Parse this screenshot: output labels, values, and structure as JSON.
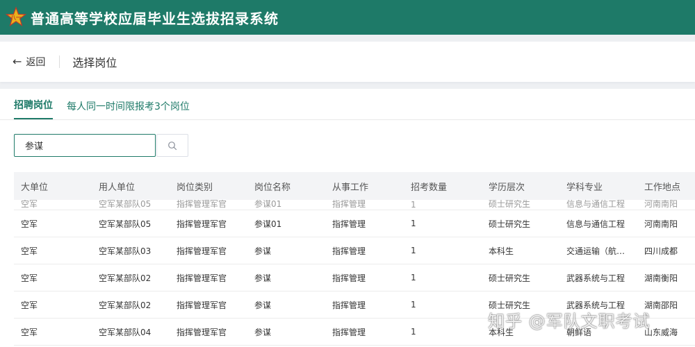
{
  "header": {
    "title": "普通高等学校应届毕业生选拔招录系统",
    "logo_icon": "army-emblem-icon",
    "brand_color": "#1e7a68"
  },
  "subheader": {
    "back_label": "返回",
    "page_title": "选择岗位"
  },
  "tabs": {
    "active_label": "招聘岗位",
    "note": "每人同一时间限报考3个岗位"
  },
  "search": {
    "value": "参谋",
    "icon": "search-icon"
  },
  "table": {
    "columns": [
      "大单位",
      "用人单位",
      "岗位类别",
      "岗位名称",
      "从事工作",
      "招考数量",
      "学历层次",
      "学科专业",
      "工作地点"
    ],
    "partial_row": [
      "空军",
      "空军某部队05",
      "指挥管理军官",
      "参谋01",
      "指挥管理",
      "1",
      "硕士研究生",
      "信息与通信工程",
      "河南南阳"
    ],
    "rows": [
      [
        "空军",
        "空军某部队05",
        "指挥管理军官",
        "参谋01",
        "指挥管理",
        "1",
        "硕士研究生",
        "信息与通信工程",
        "河南南阳"
      ],
      [
        "空军",
        "空军某部队03",
        "指挥管理军官",
        "参谋",
        "指挥管理",
        "1",
        "本科生",
        "交通运输（航…",
        "四川成都"
      ],
      [
        "空军",
        "空军某部队02",
        "指挥管理军官",
        "参谋",
        "指挥管理",
        "1",
        "硕士研究生",
        "武器系统与工程",
        "湖南衡阳"
      ],
      [
        "空军",
        "空军某部队02",
        "指挥管理军官",
        "参谋",
        "指挥管理",
        "1",
        "硕士研究生",
        "武器系统与工程",
        "湖南邵阳"
      ],
      [
        "空军",
        "空军某部队04",
        "指挥管理军官",
        "参谋",
        "指挥管理",
        "1",
        "本科生",
        "朝鲜语",
        "山东威海"
      ]
    ]
  },
  "watermark": "知乎 @军队文职考试"
}
